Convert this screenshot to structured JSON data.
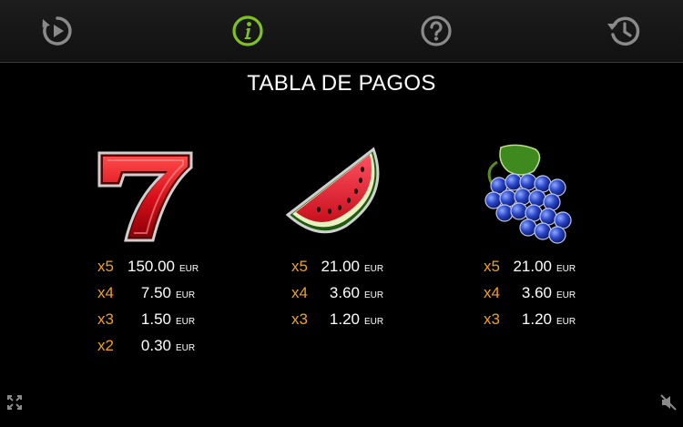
{
  "header": {
    "buttons": [
      {
        "name": "replay-icon",
        "color": "#8a8a8a"
      },
      {
        "name": "info-icon",
        "color": "#7fc31c"
      },
      {
        "name": "help-icon",
        "color": "#8a8a8a"
      },
      {
        "name": "history-icon",
        "color": "#8a8a8a"
      }
    ]
  },
  "title": "TABLA DE PAGOS",
  "currency": "EUR",
  "symbols": [
    {
      "name": "seven",
      "pays": [
        {
          "mult": "x5",
          "amount": "150.00"
        },
        {
          "mult": "x4",
          "amount": "7.50"
        },
        {
          "mult": "x3",
          "amount": "1.50"
        },
        {
          "mult": "x2",
          "amount": "0.30"
        }
      ]
    },
    {
      "name": "watermelon",
      "pays": [
        {
          "mult": "x5",
          "amount": "21.00"
        },
        {
          "mult": "x4",
          "amount": "3.60"
        },
        {
          "mult": "x3",
          "amount": "1.20"
        }
      ]
    },
    {
      "name": "grapes",
      "pays": [
        {
          "mult": "x5",
          "amount": "21.00"
        },
        {
          "mult": "x4",
          "amount": "3.60"
        },
        {
          "mult": "x3",
          "amount": "1.20"
        }
      ]
    }
  ],
  "footer": {
    "left_icon": "fullscreen-icon",
    "right_icon": "sound-off-icon"
  },
  "colors": {
    "multiplier": "#f0a020",
    "accent": "#7fc31c",
    "icon_gray": "#8a8a8a"
  }
}
